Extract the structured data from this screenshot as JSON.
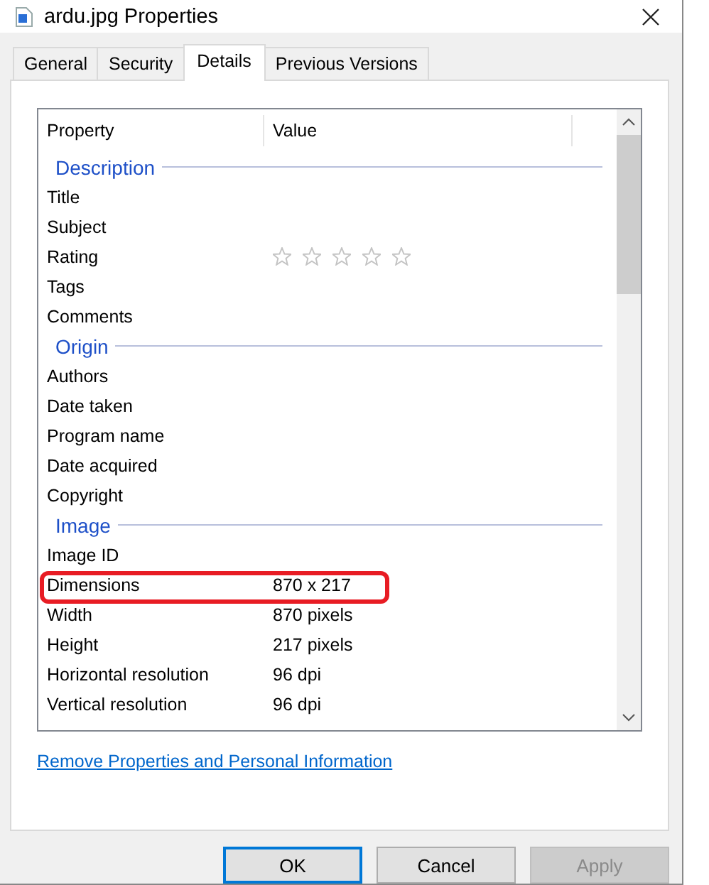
{
  "window": {
    "title": "ardu.jpg Properties"
  },
  "tabs": [
    {
      "label": "General",
      "selected": false
    },
    {
      "label": "Security",
      "selected": false
    },
    {
      "label": "Details",
      "selected": true
    },
    {
      "label": "Previous Versions",
      "selected": false
    }
  ],
  "list": {
    "columns": [
      "Property",
      "Value"
    ],
    "groups": [
      {
        "title": "Description",
        "rows": [
          {
            "kind": "text",
            "property": "Title",
            "circled": false
          },
          {
            "kind": "text",
            "property": "Subject",
            "circled": false
          },
          {
            "kind": "stars",
            "property": "Rating",
            "stars": 0,
            "circled": false
          },
          {
            "kind": "text",
            "property": "Tags",
            "circled": false
          },
          {
            "kind": "text",
            "property": "Comments",
            "circled": false
          }
        ]
      },
      {
        "title": "Origin",
        "rows": [
          {
            "kind": "text",
            "property": "Authors",
            "circled": false
          },
          {
            "kind": "text",
            "property": "Date taken",
            "circled": false
          },
          {
            "kind": "text",
            "property": "Program name",
            "circled": false
          },
          {
            "kind": "text",
            "property": "Date acquired",
            "circled": false
          },
          {
            "kind": "text",
            "property": "Copyright",
            "circled": false
          }
        ]
      },
      {
        "title": "Image",
        "rows": [
          {
            "kind": "text",
            "property": "Image ID",
            "circled": false
          },
          {
            "kind": "text",
            "property": "Dimensions",
            "value": "870 x 217",
            "circled": true
          },
          {
            "kind": "text",
            "property": "Width",
            "value": "870 pixels",
            "circled": false
          },
          {
            "kind": "text",
            "property": "Height",
            "value": "217 pixels",
            "circled": false
          },
          {
            "kind": "text",
            "property": "Horizontal resolution",
            "value": "96 dpi",
            "circled": false
          },
          {
            "kind": "text",
            "property": "Vertical resolution",
            "value": "96 dpi",
            "circled": false
          }
        ]
      }
    ]
  },
  "link": "Remove Properties and Personal Information",
  "buttons": [
    {
      "label": "OK",
      "default": true,
      "disabled": false
    },
    {
      "label": "Cancel",
      "default": false,
      "disabled": false
    },
    {
      "label": "Apply",
      "default": false,
      "disabled": true
    }
  ]
}
